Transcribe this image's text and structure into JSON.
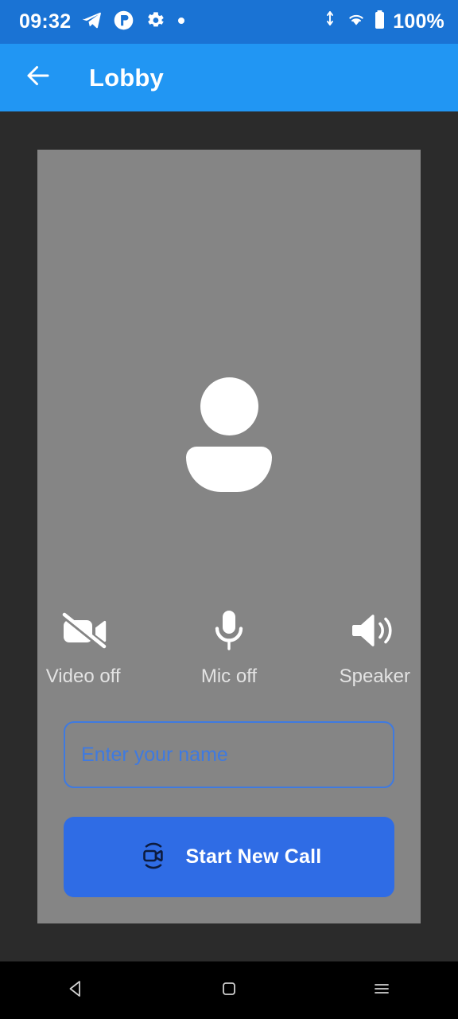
{
  "status_bar": {
    "clock": "09:32",
    "battery_text": "100%",
    "left_icons": [
      "telegram-icon",
      "app-circle-icon",
      "gear-icon",
      "dot-icon"
    ],
    "right_icons": [
      "data-transfer-icon",
      "wifi-icon",
      "battery-icon"
    ],
    "background_color": "#1a73d4"
  },
  "app_bar": {
    "title": "Lobby",
    "back_icon": "arrow-left-icon",
    "background_color": "#2196f3"
  },
  "lobby": {
    "card_background_color": "#858585",
    "avatar_icon": "person-avatar-icon",
    "controls": [
      {
        "icon": "videocam-off-icon",
        "label": "Video off"
      },
      {
        "icon": "mic-icon",
        "label": "Mic off"
      },
      {
        "icon": "volume-up-icon",
        "label": "Speaker"
      }
    ],
    "name_input": {
      "placeholder": "Enter your name",
      "value": "",
      "accent_color": "#3f7ae0"
    },
    "start_call_button": {
      "label": "Start New Call",
      "icon": "video-call-icon",
      "background_color": "#2f6ce5"
    }
  },
  "nav_bar": {
    "buttons": [
      {
        "icon": "nav-back-icon"
      },
      {
        "icon": "nav-home-icon"
      },
      {
        "icon": "nav-recents-icon"
      }
    ]
  }
}
